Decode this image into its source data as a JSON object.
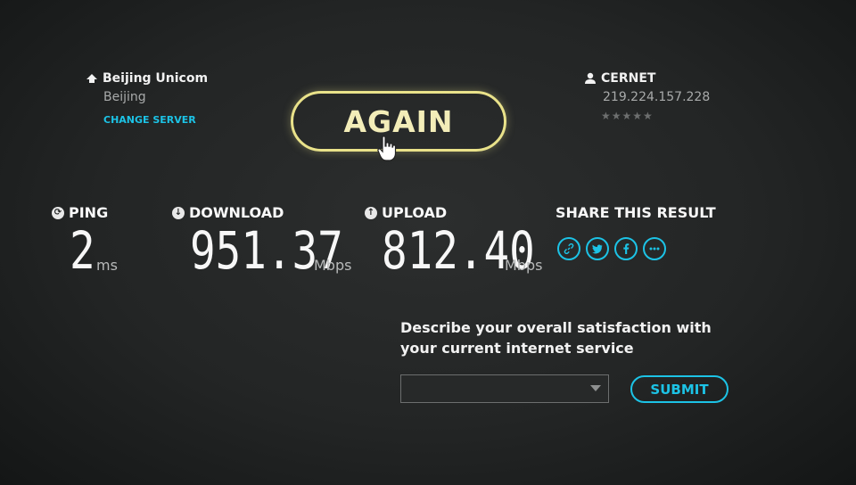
{
  "server": {
    "name": "Beijing Unicom",
    "city": "Beijing",
    "change_label": "CHANGE SERVER"
  },
  "isp": {
    "name": "CERNET",
    "ip": "219.224.157.228",
    "rating_stars": "★★★★★",
    "rating_filled": 0
  },
  "again_label": "AGAIN",
  "ping": {
    "label": "PING",
    "value": "2",
    "unit": "ms"
  },
  "download": {
    "label": "DOWNLOAD",
    "value": "951.37",
    "unit": "Mbps"
  },
  "upload": {
    "label": "UPLOAD",
    "value": "812.40",
    "unit": "Mbps"
  },
  "share": {
    "label": "SHARE THIS RESULT",
    "icons": [
      "link-icon",
      "twitter-icon",
      "facebook-icon",
      "more-icon"
    ]
  },
  "survey": {
    "question_line1": "Describe your overall satisfaction with",
    "question_line2": "your current internet service",
    "selected": "",
    "submit_label": "SUBMIT"
  },
  "colors": {
    "accent": "#1cc3e6",
    "again": "#e9e28a",
    "background": "#232525"
  }
}
